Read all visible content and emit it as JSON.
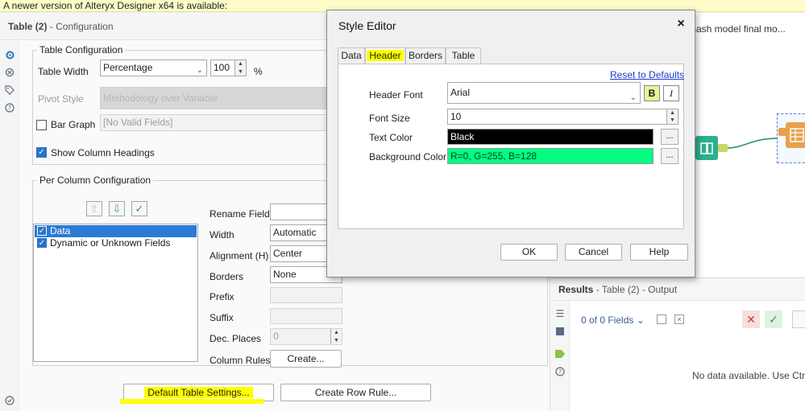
{
  "banner": {
    "text": "A newer version of Alteryx Designer x64 is available:"
  },
  "config": {
    "title_name": "Table (2)",
    "title_suffix": " - Configuration",
    "table_config_legend": "Table Configuration",
    "table_width_label": "Table Width",
    "table_width_value": "Percentage",
    "table_width_number": "100",
    "percent_sign": "%",
    "pivot_style_label": "Pivot Style",
    "pivot_style_value": "Methodology over Variable",
    "bar_graph_label": "Bar Graph",
    "bar_graph_value": "[No Valid Fields]",
    "show_headings_label": "Show Column Headings",
    "per_column_legend": "Per Column Configuration",
    "fields": [
      {
        "label": "Data",
        "checked": true,
        "selected": true
      },
      {
        "label": "Dynamic or Unknown Fields",
        "checked": true,
        "selected": false
      }
    ],
    "props": {
      "rename_label": "Rename Field",
      "width_label": "Width",
      "width_value": "Automatic",
      "alignment_label": "Alignment (H)",
      "alignment_value": "Center",
      "borders_label": "Borders",
      "borders_value": "None",
      "prefix_label": "Prefix",
      "suffix_label": "Suffix",
      "dec_places_label": "Dec. Places",
      "dec_places_value": "0",
      "column_rules_label": "Column Rules",
      "create_button": "Create..."
    },
    "default_table_settings_button": "Default Table Settings...",
    "create_row_rule_button": "Create Row Rule..."
  },
  "canvas": {
    "tab_label": "cash model final mo..."
  },
  "results": {
    "title": "Results",
    "subtitle": " - Table (2) - Output",
    "fields_dropdown": "0 of 0 Fields",
    "empty_message": "No data available. Use Ctrl+"
  },
  "style_editor": {
    "title": "Style Editor",
    "close": "×",
    "tabs": [
      "Data",
      "Header",
      "Borders",
      "Table"
    ],
    "active_tab": "Header",
    "reset_link": "Reset to Defaults",
    "header_font_label": "Header Font",
    "header_font_value": "Arial",
    "bold_glyph": "B",
    "italic_glyph": "I",
    "font_size_label": "Font Size",
    "font_size_value": "10",
    "text_color_label": "Text Color",
    "text_color_value": "Black",
    "text_color_hex": "#000000",
    "bg_color_label": "Background Color",
    "bg_color_value": "R=0, G=255, B=128",
    "bg_color_hex": "#00ff80",
    "dots": "...",
    "ok": "OK",
    "cancel": "Cancel",
    "help": "Help"
  },
  "colors": {
    "accent": "#2b7bd6",
    "highlight": "#ffff00",
    "canvas_tool_teal": "#3aa89a",
    "canvas_tool_orange": "#e8a04c"
  }
}
